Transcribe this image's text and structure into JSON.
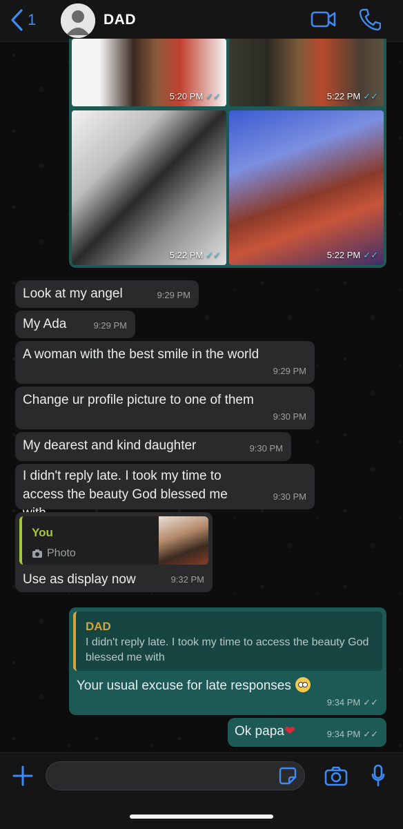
{
  "header": {
    "back_count": "1",
    "title": "DAD",
    "icons": [
      "back-chevron-icon",
      "avatar-placeholder-icon",
      "video-call-icon",
      "voice-call-icon"
    ]
  },
  "photos": [
    {
      "time": "5:20 PM"
    },
    {
      "time": "5:22 PM"
    },
    {
      "time": "5:22 PM"
    },
    {
      "time": "5:22 PM"
    }
  ],
  "ticks": "✓✓",
  "messages": [
    {
      "text": "Look at my angel",
      "time": "9:29 PM"
    },
    {
      "text": "My Ada",
      "time": "9:29 PM"
    },
    {
      "text": "A woman with the best smile in the world",
      "time": "9:29 PM"
    },
    {
      "text": "Change ur profile picture to one of them",
      "time": "9:30 PM"
    },
    {
      "text": "My dearest and kind daughter",
      "time": "9:30 PM"
    },
    {
      "text": "I didn't reply late. I took my time to access the beauty God blessed me with",
      "time": "9:30 PM"
    },
    {
      "reply_name": "You",
      "reply_type": "Photo",
      "text": "Use as display now",
      "time": "9:32 PM"
    }
  ],
  "outgoing": [
    {
      "reply_name": "DAD",
      "reply_text": "I didn't reply late. I took my time to access the beauty God blessed me with",
      "text": "Your usual excuse for late responses",
      "time": "9:34 PM"
    },
    {
      "text": "Ok papa",
      "time": "9:34 PM"
    }
  ],
  "composer": {
    "placeholder": ""
  },
  "colors": {
    "accent_blue": "#3d8bf7",
    "outgoing_bubble": "#1e5a55",
    "incoming_bubble": "#2a2a2c",
    "read_ticks": "#53bdeb"
  }
}
